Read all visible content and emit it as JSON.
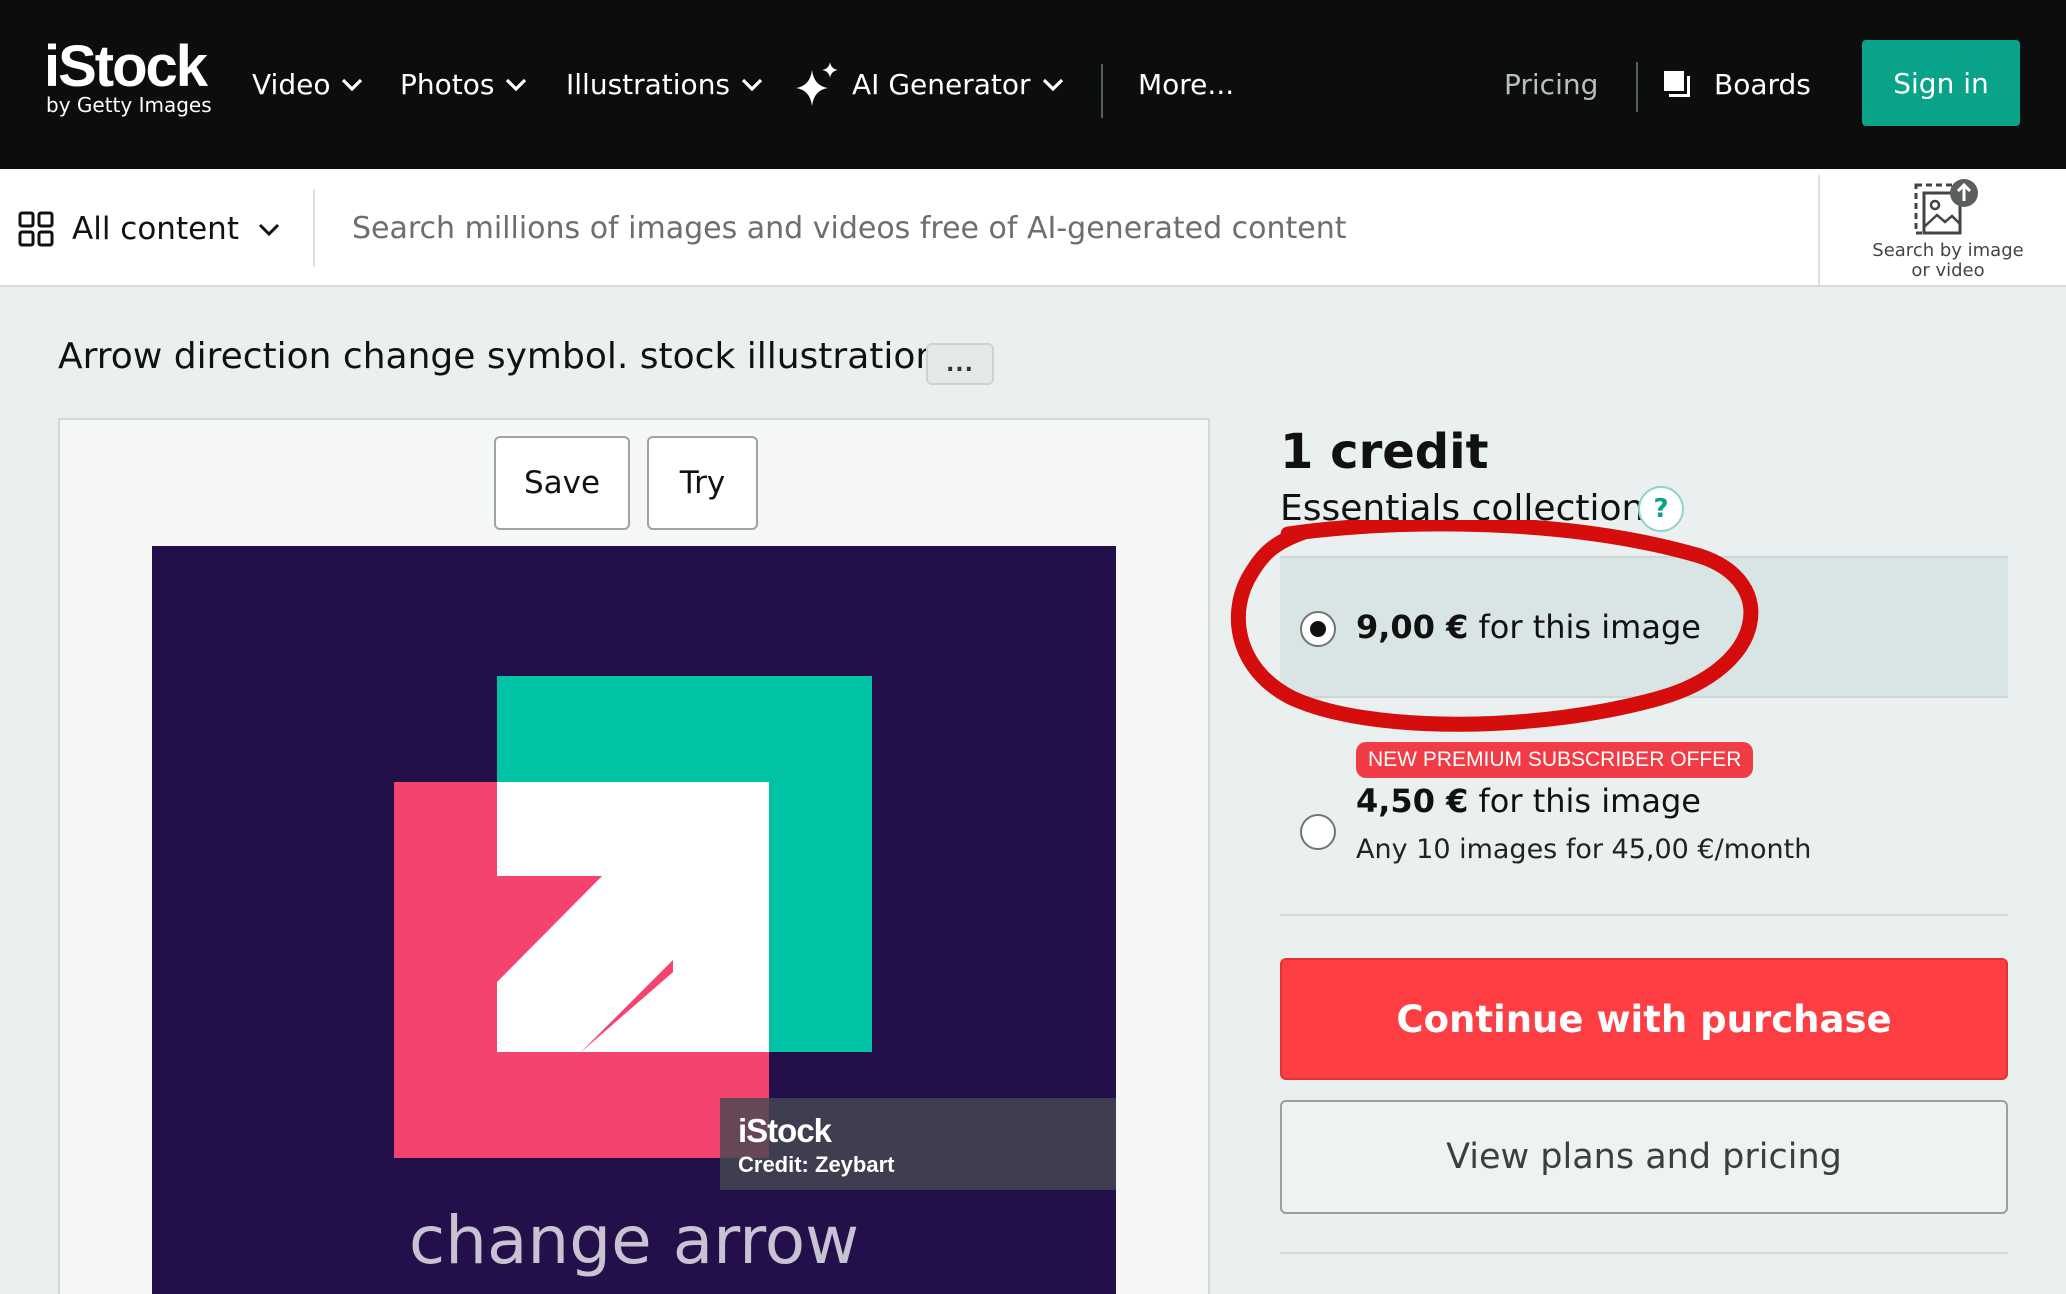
{
  "header": {
    "logo_main": "iStock",
    "logo_sub": "by Getty Images",
    "nav": [
      {
        "label": "Video"
      },
      {
        "label": "Photos"
      },
      {
        "label": "Illustrations"
      },
      {
        "label": "AI Generator"
      }
    ],
    "more_label": "More...",
    "pricing_label": "Pricing",
    "boards_label": "Boards",
    "signin_label": "Sign in",
    "signin_color": "#08a389"
  },
  "search": {
    "content_filter": "All content",
    "placeholder": "Search millions of images and videos free of AI-generated content",
    "image_search_line1": "Search by image",
    "image_search_line2": "or video"
  },
  "asset": {
    "title": "Arrow direction change symbol. stock illustration",
    "more_button": "...",
    "save_label": "Save",
    "try_label": "Try",
    "watermark_logo": "iStock",
    "watermark_credit": "Credit: Zeybart",
    "caption": "change arrow",
    "colors": {
      "background": "#230f4a",
      "teal": "#00c3a6",
      "pink": "#f5436f",
      "white": "#ffffff"
    }
  },
  "purchase": {
    "credit_title": "1 credit",
    "collection": "Essentials collection",
    "help_icon": "?",
    "options": [
      {
        "price": "9,00 €",
        "suffix": " for this image",
        "selected": true
      },
      {
        "badge": "NEW PREMIUM SUBSCRIBER OFFER",
        "price": "4,50 €",
        "suffix": " for this image",
        "detail": "Any 10 images for 45,00 €/month",
        "selected": false
      }
    ],
    "continue_label": "Continue with purchase",
    "plans_label": "View plans and pricing",
    "continue_color": "#fd3f44",
    "annotation_color": "#d40000"
  }
}
